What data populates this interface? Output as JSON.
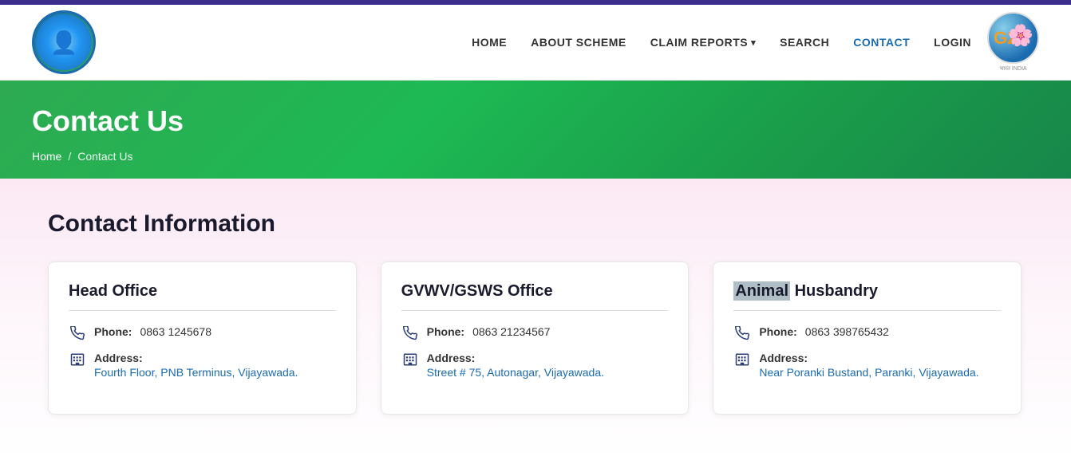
{
  "topbar": {},
  "header": {
    "logo_alt": "YSR Scheme Logo",
    "nav": {
      "home": "HOME",
      "about": "ABOUT SCHEME",
      "claims": "CLAIM REPORTS",
      "search": "SEARCH",
      "contact": "CONTACT",
      "login": "LOGIN"
    },
    "g20_alt": "G20 India Logo"
  },
  "banner": {
    "title": "Contact Us",
    "breadcrumb_home": "Home",
    "breadcrumb_sep": "/",
    "breadcrumb_current": "Contact Us"
  },
  "content": {
    "section_title": "Contact Information",
    "cards": [
      {
        "id": "head-office",
        "title": "Head Office",
        "phone_label": "Phone:",
        "phone_value": "0863 1245678",
        "address_label": "Address:",
        "address_value": "Fourth Floor, PNB Terminus, Vijayawada."
      },
      {
        "id": "gvwv-office",
        "title": "GVWV/GSWS Office",
        "phone_label": "Phone:",
        "phone_value": "0863 21234567",
        "address_label": "Address:",
        "address_value": "Street # 75, Autonagar, Vijayawada."
      },
      {
        "id": "animal-husbandry",
        "title_part1": "Animal",
        "title_part2": " Husbandry",
        "phone_label": "Phone:",
        "phone_value": "0863 398765432",
        "address_label": "Address:",
        "address_value": "Near Poranki Bustand, Paranki, Vijayawada."
      }
    ]
  }
}
